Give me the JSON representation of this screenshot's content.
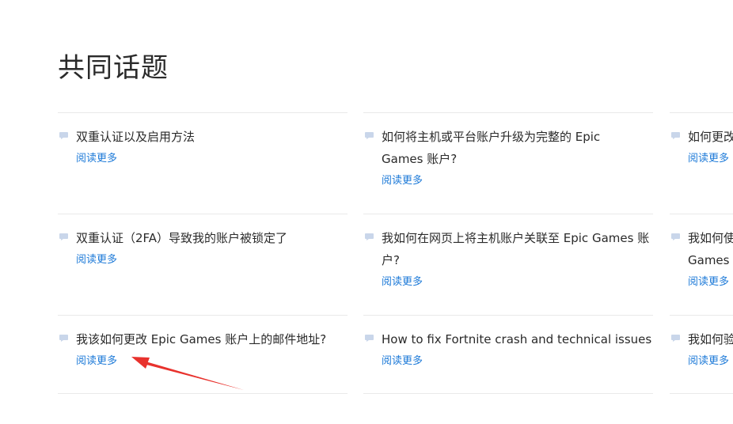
{
  "section": {
    "title": "共同话题"
  },
  "read_more_label": "阅读更多",
  "colors": {
    "link": "#1d7ad8",
    "bubble": "#c9d6ea",
    "annotation_arrow": "#e8322d",
    "divider": "#e9e9e9"
  },
  "cards": [
    {
      "title": "双重认证以及启用方法",
      "read_more": "阅读更多"
    },
    {
      "title": "如何将主机或平台账户升级为完整的 Epic Games 账户?",
      "read_more": "阅读更多"
    },
    {
      "title": "如何更改",
      "read_more": "阅读更多"
    },
    {
      "title": "双重认证（2FA）导致我的账户被锁定了",
      "read_more": "阅读更多"
    },
    {
      "title": "我如何在网页上将主机账户关联至 Epic Games 账户?",
      "read_more": "阅读更多"
    },
    {
      "title": "我如何使 Games",
      "read_more": "阅读更多"
    },
    {
      "title": "我该如何更改 Epic Games 账户上的邮件地址?",
      "read_more": "阅读更多"
    },
    {
      "title": "How to fix Fortnite crash and technical issues",
      "read_more": "阅读更多"
    },
    {
      "title": "我如何验",
      "read_more": "阅读更多"
    }
  ]
}
